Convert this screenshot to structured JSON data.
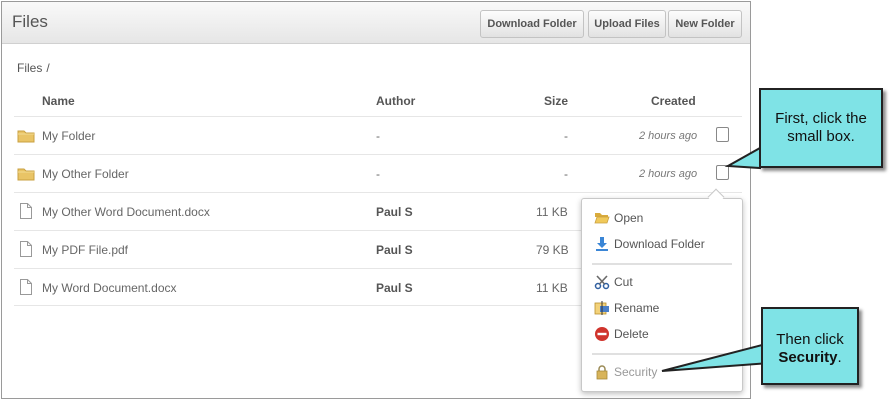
{
  "header": {
    "title": "Files",
    "buttons": {
      "download_folder": "Download Folder",
      "upload_files": "Upload Files",
      "new_folder": "New Folder"
    }
  },
  "breadcrumb": {
    "root": "Files",
    "separator": "/"
  },
  "table": {
    "columns": {
      "name": "Name",
      "author": "Author",
      "size": "Size",
      "created": "Created"
    },
    "rows": [
      {
        "type": "folder",
        "name": "My Folder",
        "author": "-",
        "size": "-",
        "created": "2 hours ago"
      },
      {
        "type": "folder",
        "name": "My Other Folder",
        "author": "-",
        "size": "-",
        "created": "2 hours ago"
      },
      {
        "type": "document",
        "name": "My Other Word Document.docx",
        "author": "Paul S",
        "size": "11 KB",
        "created": ""
      },
      {
        "type": "document",
        "name": "My PDF File.pdf",
        "author": "Paul S",
        "size": "79 KB",
        "created": ""
      },
      {
        "type": "document",
        "name": "My Word Document.docx",
        "author": "Paul S",
        "size": "11 KB",
        "created": ""
      }
    ]
  },
  "context_menu": {
    "items": [
      {
        "label": "Open",
        "icon": "folder-open-icon"
      },
      {
        "label": "Download Folder",
        "icon": "download-icon"
      },
      {
        "label": "Cut",
        "icon": "scissors-icon"
      },
      {
        "label": "Rename",
        "icon": "rename-icon"
      },
      {
        "label": "Delete",
        "icon": "delete-icon"
      },
      {
        "label": "Security",
        "icon": "lock-icon"
      }
    ]
  },
  "callouts": {
    "first": {
      "line1": "First, click the",
      "line2": "small box."
    },
    "second": {
      "line1": "Then click",
      "bold": "Security",
      "suffix": "."
    }
  },
  "colors": {
    "callout_fill": "#7fe3e6",
    "folder": "#e9c466",
    "delete_red": "#d0342c",
    "download_blue": "#3b86d6"
  }
}
